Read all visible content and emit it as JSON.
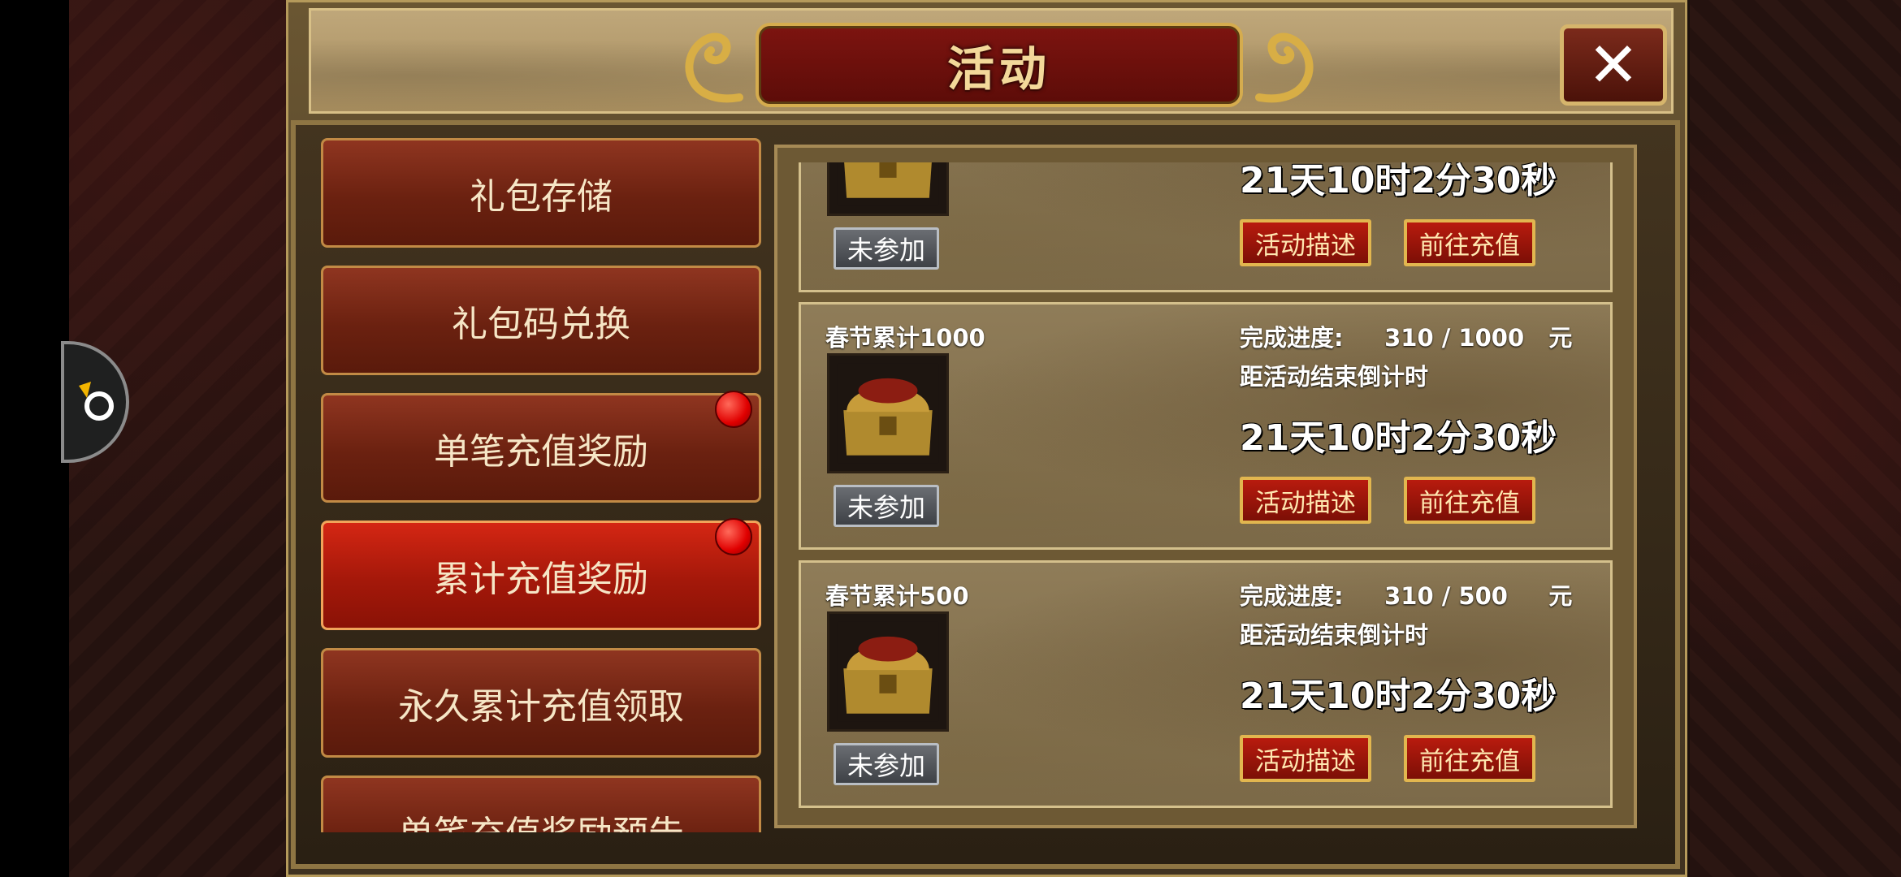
{
  "header": {
    "title": "活动",
    "close_icon": "close-icon"
  },
  "sidebar": {
    "items": [
      {
        "label": "礼包存储",
        "active": false,
        "badge": false
      },
      {
        "label": "礼包码兑换",
        "active": false,
        "badge": false
      },
      {
        "label": "单笔充值奖励",
        "active": false,
        "badge": true
      },
      {
        "label": "累计充值奖励",
        "active": true,
        "badge": true
      },
      {
        "label": "永久累计充值领取",
        "active": false,
        "badge": false
      },
      {
        "label": "单笔充值奖励预告",
        "active": false,
        "badge": false
      }
    ]
  },
  "activities": [
    {
      "name": "",
      "progress_label": "",
      "progress": "",
      "countdown_label": "",
      "countdown": "21天10时2分30秒",
      "status": "未参加",
      "describe_label": "活动描述",
      "recharge_label": "前往充值"
    },
    {
      "name": "春节累计1000",
      "progress_label": "完成进度:",
      "progress": "310 / 1000   元",
      "countdown_label": "距活动结束倒计时",
      "countdown": "21天10时2分30秒",
      "status": "未参加",
      "describe_label": "活动描述",
      "recharge_label": "前往充值"
    },
    {
      "name": "春节累计500",
      "progress_label": "完成进度:",
      "progress": "310 / 500     元",
      "countdown_label": "距活动结束倒计时",
      "countdown": "21天10时2分30秒",
      "status": "未参加",
      "describe_label": "活动描述",
      "recharge_label": "前往充值"
    }
  ],
  "colors": {
    "active_tab": "#c01a0c",
    "tab": "#6b2110",
    "gold_border": "#d6b56c",
    "badge": "#e00000"
  }
}
